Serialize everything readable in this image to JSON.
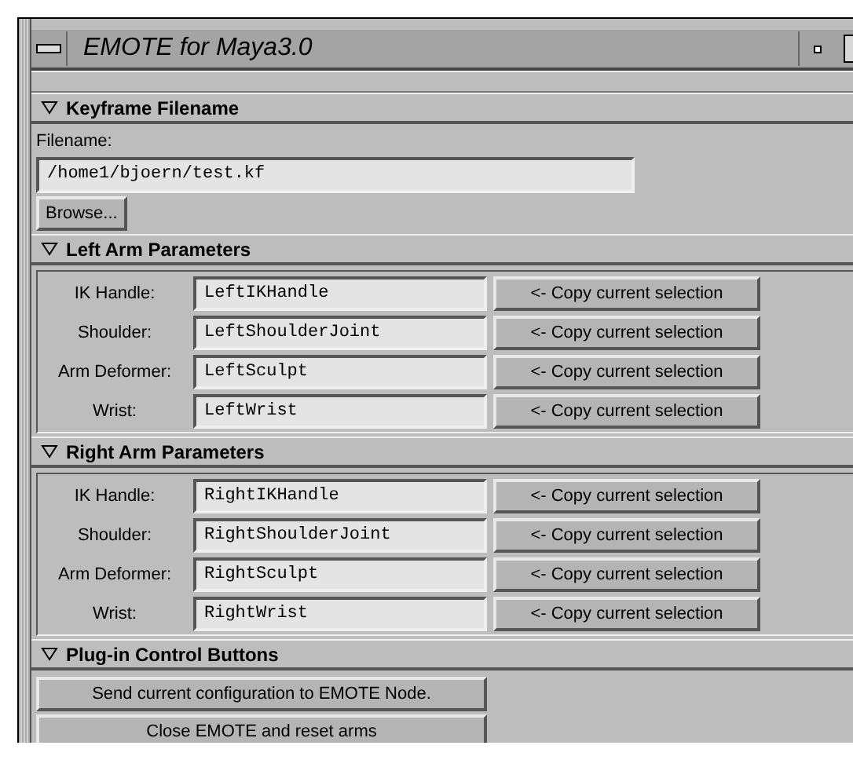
{
  "window": {
    "title": "EMOTE for Maya3.0"
  },
  "sections": [
    {
      "title": "Keyframe Filename",
      "expanded": true,
      "kind": "file",
      "label": "Filename:",
      "value": "/home1/bjoern/test.kf",
      "button": "Browse..."
    },
    {
      "title": "Left Arm Parameters",
      "expanded": true,
      "kind": "params",
      "rows": [
        {
          "label": "IK Handle:",
          "value": "LeftIKHandle",
          "button": "<- Copy current selection"
        },
        {
          "label": "Shoulder:",
          "value": "LeftShoulderJoint",
          "button": "<- Copy current selection"
        },
        {
          "label": "Arm Deformer:",
          "value": "LeftSculpt",
          "button": "<- Copy current selection"
        },
        {
          "label": "Wrist:",
          "value": "LeftWrist",
          "button": "<- Copy current selection"
        }
      ]
    },
    {
      "title": "Right Arm Parameters",
      "expanded": true,
      "kind": "params",
      "rows": [
        {
          "label": "IK Handle:",
          "value": "RightIKHandle",
          "button": "<- Copy current selection"
        },
        {
          "label": "Shoulder:",
          "value": "RightShoulderJoint",
          "button": "<- Copy current selection"
        },
        {
          "label": "Arm Deformer:",
          "value": "RightSculpt",
          "button": "<- Copy current selection"
        },
        {
          "label": "Wrist:",
          "value": "RightWrist",
          "button": "<- Copy current selection"
        }
      ]
    },
    {
      "title": "Plug-in Control Buttons",
      "expanded": true,
      "kind": "buttons",
      "buttons": [
        "Send current configuration to EMOTE Node.",
        "Close EMOTE and reset arms"
      ]
    }
  ]
}
